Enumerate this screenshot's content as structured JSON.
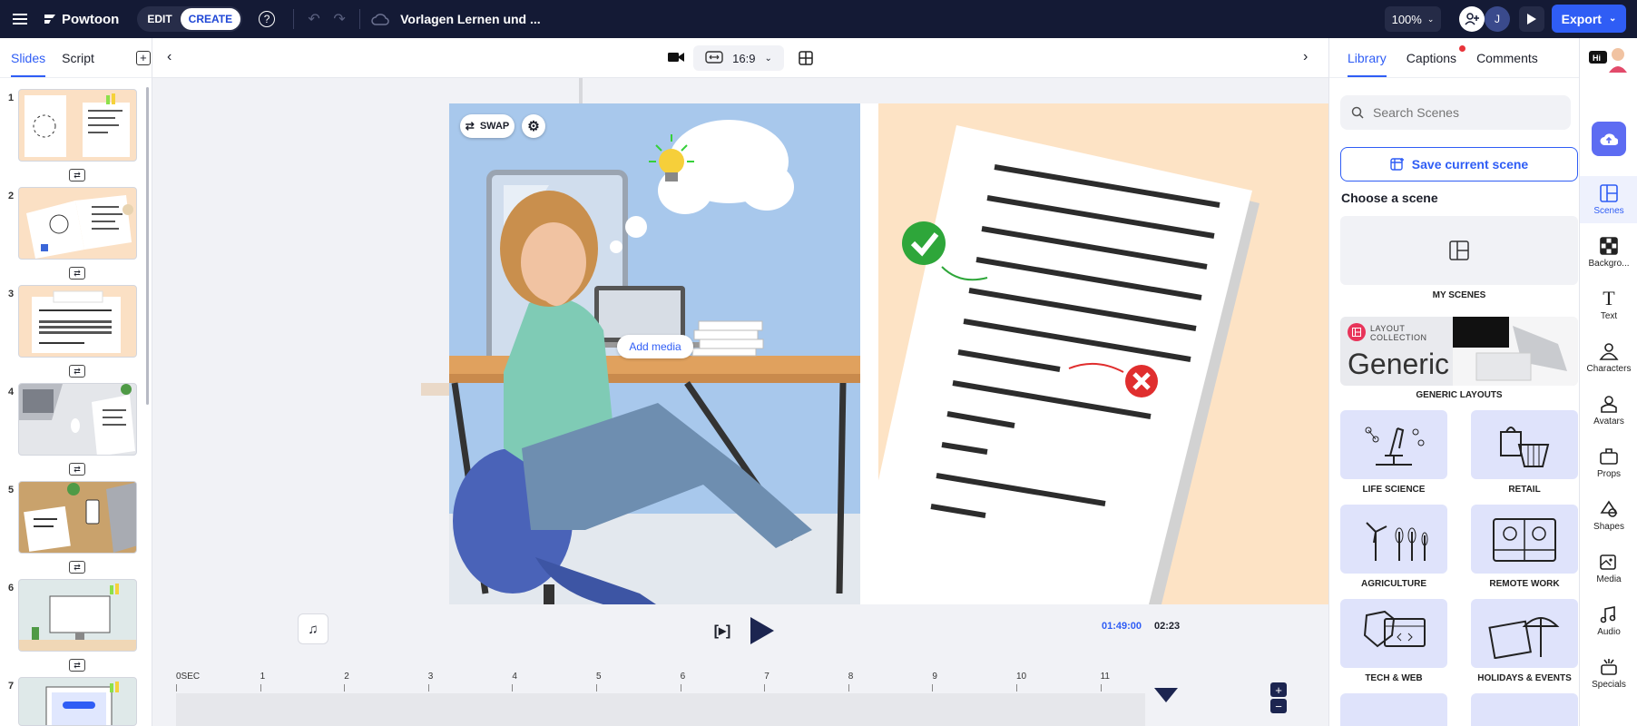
{
  "topbar": {
    "brand": "Powtoon",
    "mode_edit": "EDIT",
    "mode_create": "CREATE",
    "help": "?",
    "doc_title": "Vorlagen Lernen und ...",
    "zoom": "100%",
    "avatar_initial": "J",
    "export_label": "Export"
  },
  "slides_panel": {
    "tabs": [
      "Slides",
      "Script"
    ],
    "slide_numbers": [
      "1",
      "2",
      "3",
      "4",
      "5",
      "6",
      "7"
    ]
  },
  "editor": {
    "aspect_ratio": "16:9",
    "swap_label": "SWAP",
    "add_media_label": "Add media"
  },
  "player": {
    "current_time": "01:49:00",
    "total_time": "02:23"
  },
  "timeline": {
    "ticks": [
      "0SEC",
      "1",
      "2",
      "3",
      "4",
      "5",
      "6",
      "7",
      "8",
      "9",
      "10",
      "11"
    ],
    "zoom_in": "+",
    "zoom_out": "−"
  },
  "library": {
    "tabs": [
      "Library",
      "Captions",
      "Comments"
    ],
    "search_placeholder": "Search Scenes",
    "save_label": "Save current scene",
    "choose_label": "Choose a scene",
    "my_scenes": "MY SCENES",
    "layout_collection_line1": "LAYOUT",
    "layout_collection_line2": "COLLECTION",
    "generic_word": "Generic",
    "generic_label": "GENERIC LAYOUTS",
    "categories": [
      "LIFE SCIENCE",
      "RETAIL",
      "AGRICULTURE",
      "REMOTE WORK",
      "TECH & WEB",
      "HOLIDAYS & EVENTS"
    ]
  },
  "rail": {
    "items": [
      "Scenes",
      "Backgro...",
      "Text",
      "Characters",
      "Avatars",
      "Props",
      "Shapes",
      "Media",
      "Audio",
      "Specials"
    ]
  },
  "colors": {
    "topbar": "#141a35",
    "accent": "#2f5df5",
    "scene_blue": "#a8c8ec",
    "scene_peach": "#fde3c5"
  }
}
